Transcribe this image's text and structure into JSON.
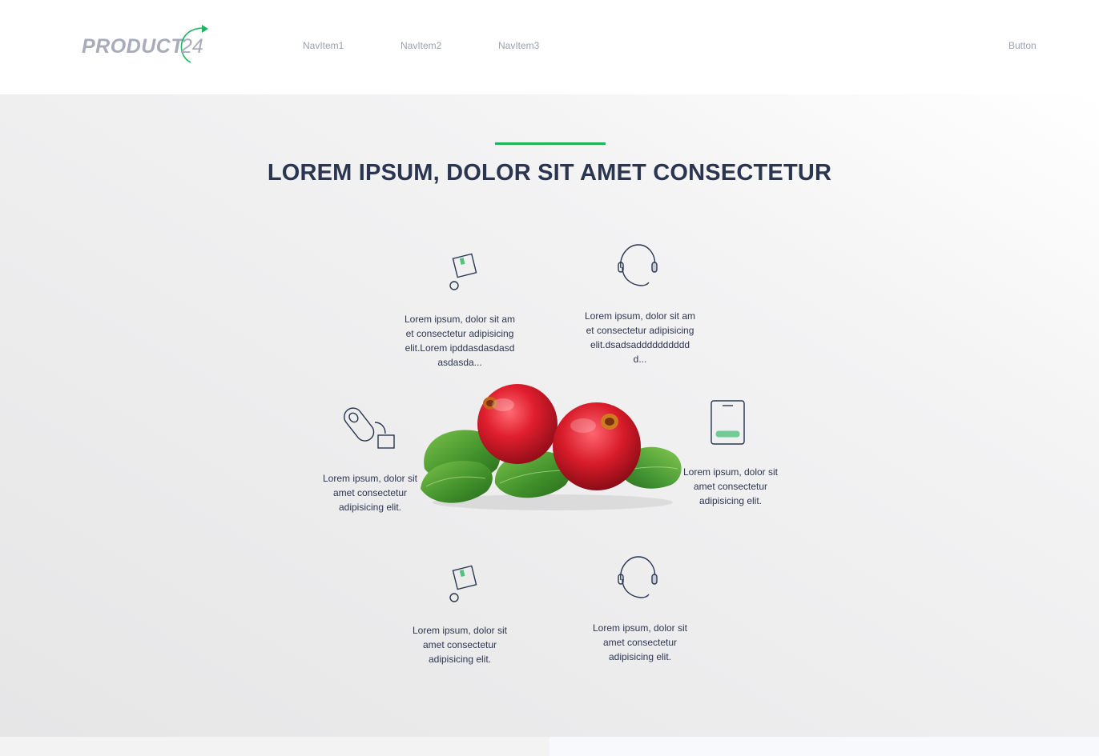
{
  "header": {
    "logo_text": "PRODUCT",
    "logo_number": "24",
    "nav": [
      "NavItem1",
      "NavItem2",
      "NavItem3"
    ],
    "button_label": "Button"
  },
  "hero": {
    "title": "LOREM IPSUM, DOLOR SIT AMET CONSECTETUR",
    "accent_color": "#1db45a",
    "features": [
      {
        "icon": "box-ball-icon",
        "text": "Lorem ipsum, dolor sit amet consectetur adipisicing elit.Lorem ipddasdasdasdasdasda..."
      },
      {
        "icon": "headset-icon",
        "text": "Lorem ipsum, dolor sit amet consectetur adipisicing elit.dsadsaddddddddddd..."
      },
      {
        "icon": "mouse-box-icon",
        "text": "Lorem ipsum, dolor sit amet consectetur adipisicing elit."
      },
      {
        "icon": "card-reader-icon",
        "text": "Lorem ipsum, dolor sit amet consectetur adipisicing elit."
      },
      {
        "icon": "box-ball-icon",
        "text": "Lorem ipsum, dolor sit amet consectetur adipisicing elit."
      },
      {
        "icon": "headset-icon",
        "text": "Lorem ipsum, dolor sit amet consectetur adipisicing elit."
      }
    ]
  }
}
